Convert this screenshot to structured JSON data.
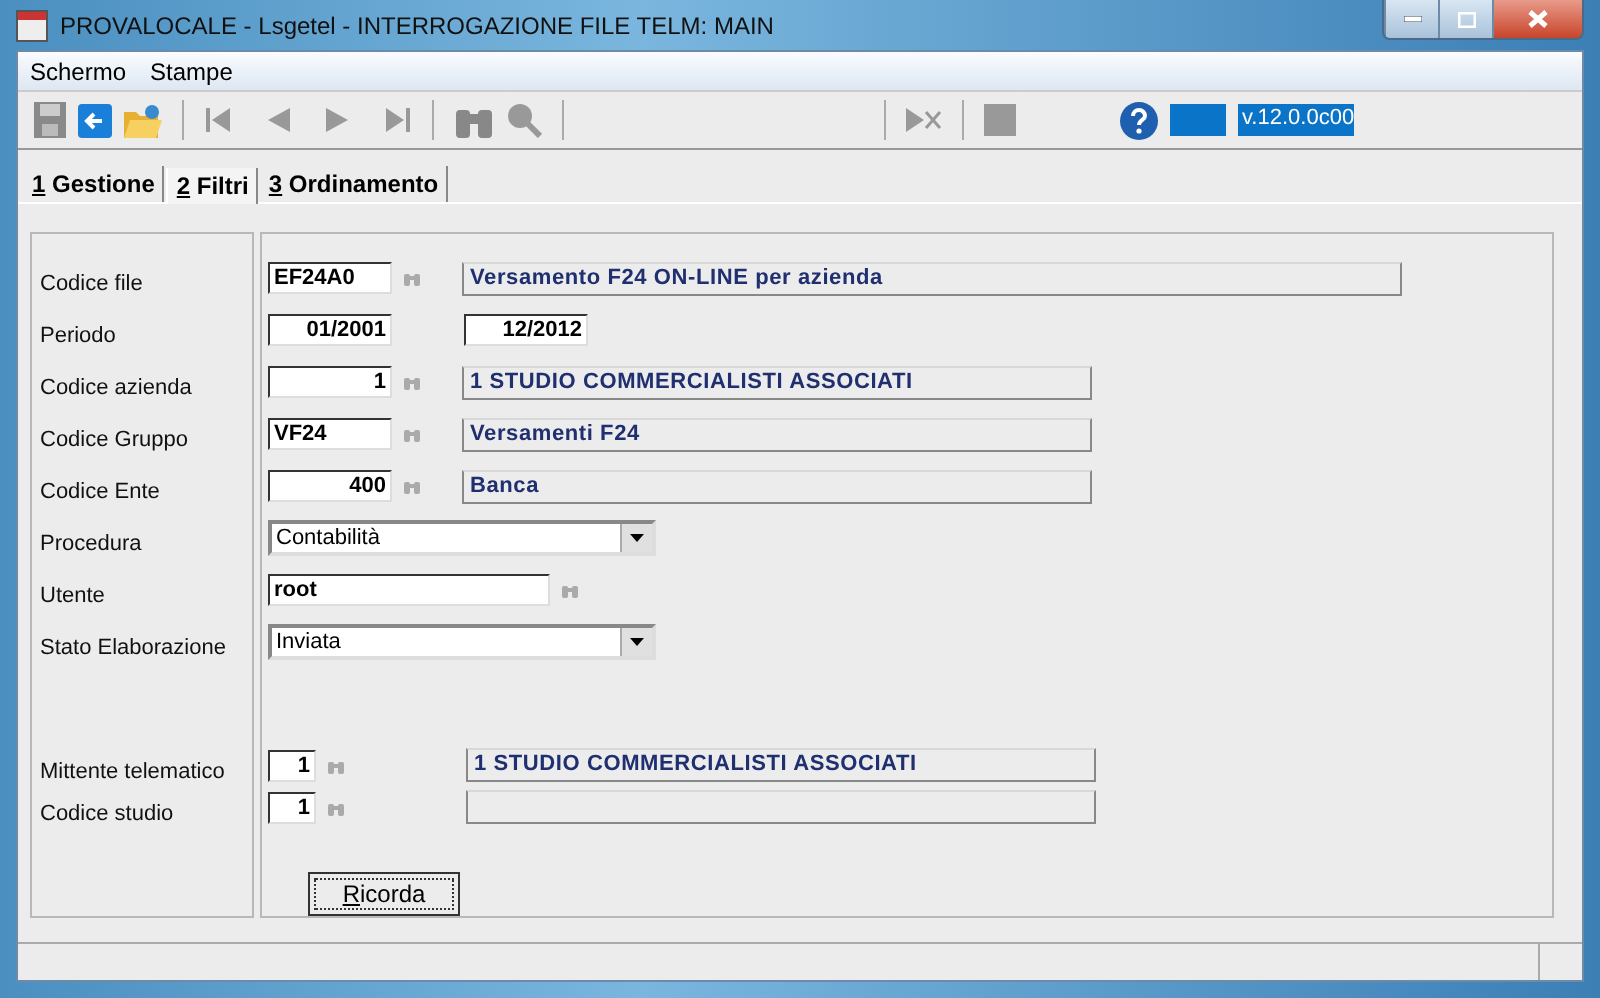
{
  "window": {
    "title": "PROVALOCALE - Lsgetel - INTERROGAZIONE FILE TELM: MAIN"
  },
  "menu": [
    "Schermo",
    "Stampe"
  ],
  "toolbar": {
    "version": "v.12.0.0c00"
  },
  "tabs": [
    {
      "label": "1 Gestione",
      "selected": false
    },
    {
      "label": "2 Filtri",
      "selected": true
    },
    {
      "label": "3 Ordinamento",
      "selected": false
    }
  ],
  "fields": [
    {
      "kind": "lookup",
      "label": "Codice file",
      "code": "EF24A0",
      "numeric": false,
      "description": "Versamento F24 ON-LINE per azienda"
    },
    {
      "kind": "range",
      "label": "Periodo",
      "from": "01/2001",
      "to": "12/2012"
    },
    {
      "kind": "lookup",
      "label": "Codice azienda",
      "code": "1",
      "numeric": true,
      "description": "1 STUDIO COMMERCIALISTI ASSOCIATI"
    },
    {
      "kind": "lookup",
      "label": "Codice Gruppo",
      "code": "VF24",
      "numeric": false,
      "description": "Versamenti F24"
    },
    {
      "kind": "lookup",
      "label": "Codice Ente",
      "code": "400",
      "numeric": true,
      "description": "Banca"
    },
    {
      "kind": "select",
      "label": "Procedura",
      "value": "Contabilità"
    },
    {
      "kind": "text",
      "label": "Utente",
      "value": "root"
    },
    {
      "kind": "select",
      "label": "Stato Elaborazione",
      "value": "Inviata"
    }
  ],
  "sender_fields": [
    {
      "kind": "lookup",
      "label": "Mittente telematico",
      "code": "1",
      "numeric": true,
      "description": "1 STUDIO COMMERCIALISTI ASSOCIATI"
    },
    {
      "kind": "lookup",
      "label": "Codice studio",
      "code": "1",
      "numeric": true
    }
  ],
  "button": "Ricorda"
}
